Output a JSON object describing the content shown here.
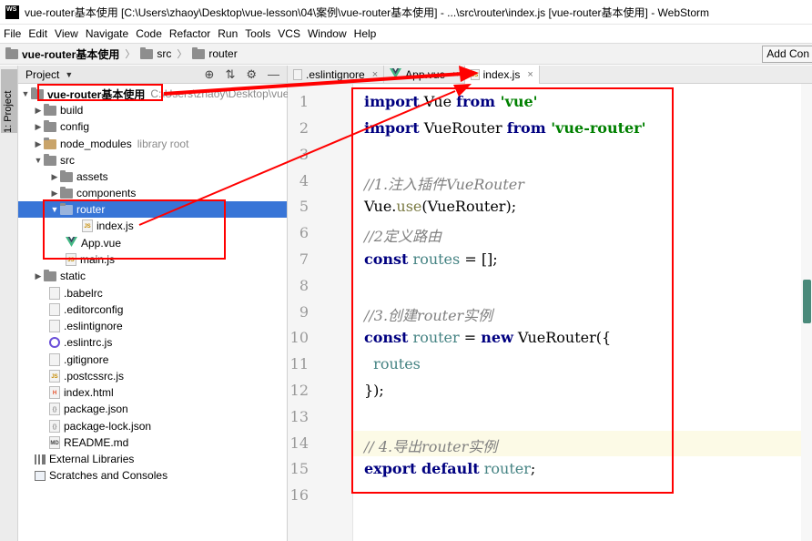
{
  "window": {
    "title": "vue-router基本使用 [C:\\Users\\zhaoy\\Desktop\\vue-lesson\\04\\案例\\vue-router基本使用] - ...\\src\\router\\index.js [vue-router基本使用] - WebStorm",
    "logo_text": "WS"
  },
  "menu": [
    "File",
    "Edit",
    "View",
    "Navigate",
    "Code",
    "Refactor",
    "Run",
    "Tools",
    "VCS",
    "Window",
    "Help"
  ],
  "breadcrumb": {
    "items": [
      "vue-router基本使用",
      "src",
      "router"
    ],
    "add_config": "Add Con"
  },
  "toolstrip": {
    "label": "1: Project"
  },
  "project": {
    "header": "Project",
    "root_name": "vue-router基本使用",
    "root_path": "C:\\Users\\zhaoy\\Desktop\\vue-le",
    "items": {
      "build": "build",
      "config": "config",
      "node_modules": "node_modules",
      "library_root": "library root",
      "src": "src",
      "assets": "assets",
      "components": "components",
      "router": "router",
      "index_js": "index.js",
      "app_vue": "App.vue",
      "main_js": "main.js",
      "static": "static",
      "babelrc": ".babelrc",
      "editorconfig": ".editorconfig",
      "eslintignore": ".eslintignore",
      "eslintrc": ".eslintrc.js",
      "gitignore": ".gitignore",
      "postcssrc": ".postcssrc.js",
      "index_html": "index.html",
      "package_json": "package.json",
      "package_lock": "package-lock.json",
      "readme": "README.md",
      "external_libraries": "External Libraries",
      "scratches": "Scratches and Consoles"
    }
  },
  "tabs": [
    {
      "label": ".eslintignore",
      "close": "×"
    },
    {
      "label": "App.vue",
      "close": "×"
    },
    {
      "label": "index.js",
      "close": "×"
    }
  ],
  "editor": {
    "line_numbers": [
      "1",
      "2",
      "3",
      "4",
      "5",
      "6",
      "7",
      "8",
      "9",
      "10",
      "11",
      "12",
      "13",
      "14",
      "15",
      "16"
    ],
    "lines": {
      "l1": {
        "kw1": "import",
        "t1": " Vue ",
        "kw2": "from",
        "str": " 'vue'"
      },
      "l2": {
        "kw1": "import",
        "t1": " VueRouter ",
        "kw2": "from",
        "str": " 'vue-router'"
      },
      "l4": {
        "cm": "//1.注入插件VueRouter"
      },
      "l5": {
        "t1": "Vue.",
        "fn": "use",
        "t2": "(VueRouter);"
      },
      "l6": {
        "cm": "//2定义路由"
      },
      "l7": {
        "kw": "const",
        "id": " routes",
        "t1": " = [];"
      },
      "l9": {
        "cm": "//3.创建router实例"
      },
      "l10": {
        "kw": "const",
        "id": " router",
        "t1": " = ",
        "kw2": "new",
        "t2": " VueRouter({"
      },
      "l11": {
        "id": "  routes"
      },
      "l12": {
        "t1": "});"
      },
      "l14": {
        "cm": "// 4.导出router实例"
      },
      "l15": {
        "kw": "export default",
        "id": " router",
        "t1": ";"
      }
    }
  },
  "colors": {
    "annotation_red": "#ff0000",
    "selection_blue": "#3875d7",
    "keyword": "#000080",
    "string": "#008000",
    "comment": "#808080"
  }
}
